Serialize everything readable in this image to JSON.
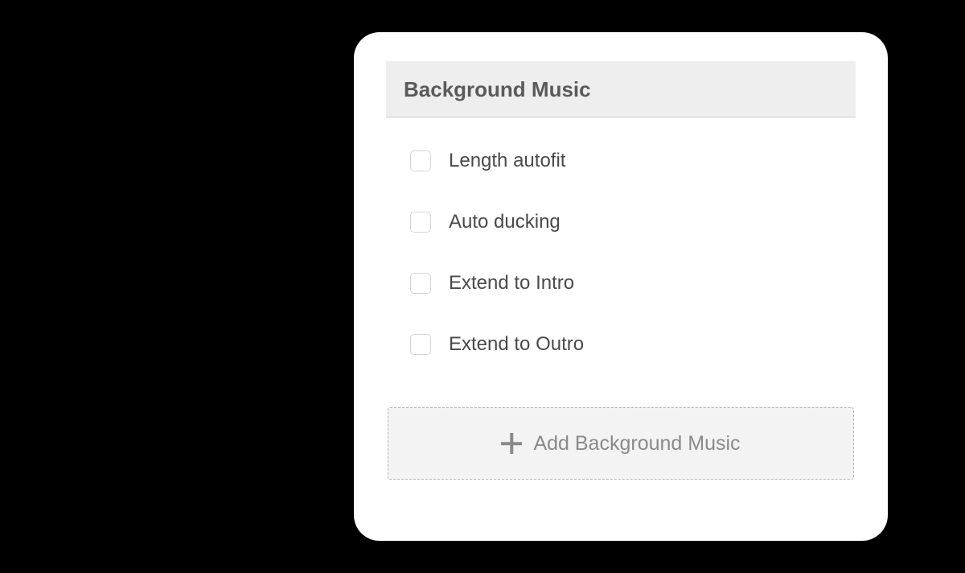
{
  "panel": {
    "title": "Background Music",
    "options": [
      {
        "label": "Length autofit",
        "checked": false
      },
      {
        "label": "Auto ducking",
        "checked": false
      },
      {
        "label": "Extend to Intro",
        "checked": false
      },
      {
        "label": "Extend to Outro",
        "checked": false
      }
    ],
    "add_button_label": "Add Background Music"
  }
}
